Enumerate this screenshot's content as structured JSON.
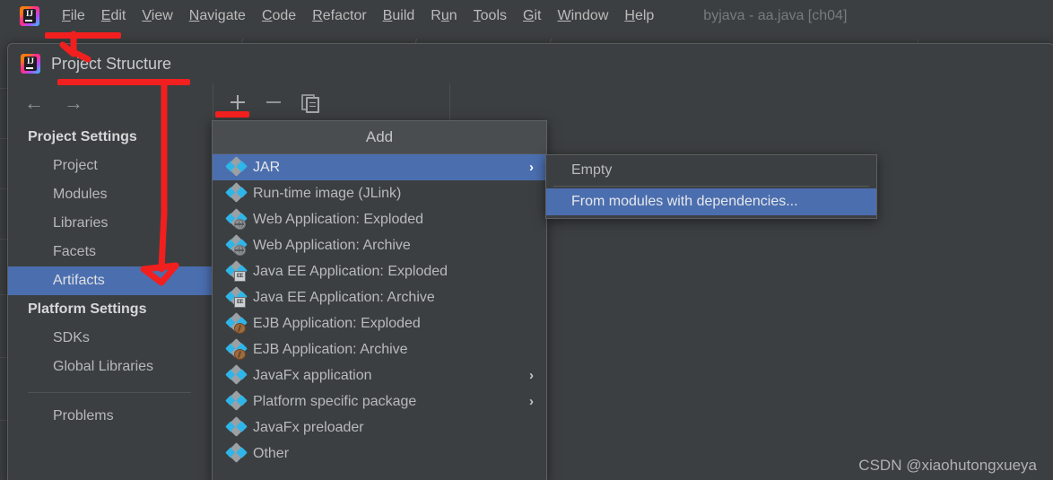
{
  "ide": {
    "logo_alt": "intellij-idea-logo",
    "window_title": "byjava - aa.java [ch04]",
    "menus": [
      {
        "mnemonic": "F",
        "rest": "ile"
      },
      {
        "mnemonic": "E",
        "rest": "dit"
      },
      {
        "mnemonic": "V",
        "rest": "iew"
      },
      {
        "mnemonic": "N",
        "rest": "avigate"
      },
      {
        "mnemonic": "C",
        "rest": "ode"
      },
      {
        "mnemonic": "R",
        "rest": "efactor"
      },
      {
        "mnemonic": "B",
        "rest": "uild"
      },
      {
        "mnemonic": "R",
        "rest": "un",
        "prefix": "R",
        "mid": "u",
        "suffix": "n"
      },
      {
        "mnemonic": "T",
        "rest": "ools"
      },
      {
        "mnemonic": "G",
        "rest": "it"
      },
      {
        "mnemonic": "W",
        "rest": "indow"
      },
      {
        "mnemonic": "H",
        "rest": "elp"
      }
    ]
  },
  "dialog": {
    "title": "Project Structure",
    "nav_back": "←",
    "nav_forward": "→",
    "sidebar": {
      "groups": [
        {
          "label": "Project Settings",
          "items": [
            {
              "label": "Project",
              "selected": false
            },
            {
              "label": "Modules",
              "selected": false
            },
            {
              "label": "Libraries",
              "selected": false
            },
            {
              "label": "Facets",
              "selected": false
            },
            {
              "label": "Artifacts",
              "selected": true
            }
          ]
        },
        {
          "label": "Platform Settings",
          "items": [
            {
              "label": "SDKs",
              "selected": false
            },
            {
              "label": "Global Libraries",
              "selected": false
            }
          ]
        }
      ],
      "footer_items": [
        {
          "label": "Problems",
          "selected": false
        }
      ]
    },
    "toolbar": {
      "add": "add-icon",
      "remove": "remove-icon",
      "copy": "copy-icon"
    }
  },
  "add_menu": {
    "header": "Add",
    "items": [
      {
        "label": "JAR",
        "icon": "artifact-jar-icon",
        "badge": "none",
        "submenu": true,
        "selected": true
      },
      {
        "label": "Run-time image (JLink)",
        "icon": "artifact-jlink-icon",
        "badge": "none",
        "submenu": false,
        "selected": false
      },
      {
        "label": "Web Application: Exploded",
        "icon": "artifact-web-icon",
        "badge": "globe",
        "submenu": false,
        "selected": false
      },
      {
        "label": "Web Application: Archive",
        "icon": "artifact-web-icon",
        "badge": "globe",
        "submenu": false,
        "selected": false
      },
      {
        "label": "Java EE Application: Exploded",
        "icon": "artifact-javaee-icon",
        "badge": "ee",
        "badge_text": "EE",
        "submenu": false,
        "selected": false
      },
      {
        "label": "Java EE Application: Archive",
        "icon": "artifact-javaee-icon",
        "badge": "ee",
        "badge_text": "EE",
        "submenu": false,
        "selected": false
      },
      {
        "label": "EJB Application: Exploded",
        "icon": "artifact-ejb-icon",
        "badge": "bean",
        "submenu": false,
        "selected": false
      },
      {
        "label": "EJB Application: Archive",
        "icon": "artifact-ejb-icon",
        "badge": "bean",
        "submenu": false,
        "selected": false
      },
      {
        "label": "JavaFx application",
        "icon": "artifact-javafx-icon",
        "badge": "none",
        "submenu": true,
        "selected": false
      },
      {
        "label": "Platform specific package",
        "icon": "artifact-platform-icon",
        "badge": "none",
        "submenu": true,
        "selected": false
      },
      {
        "label": "JavaFx preloader",
        "icon": "artifact-javafx-preloader-icon",
        "badge": "none",
        "submenu": false,
        "selected": false
      },
      {
        "label": "Other",
        "icon": "artifact-other-icon",
        "badge": "none",
        "submenu": false,
        "selected": false
      }
    ],
    "submenu_arrow": "›"
  },
  "jar_submenu": {
    "items": [
      {
        "label": "Empty",
        "selected": false
      },
      {
        "label": "From modules with dependencies...",
        "selected": true
      }
    ]
  },
  "watermark": "CSDN @xiaohutongxueya",
  "colors": {
    "dialog_bg": "#3c3f41",
    "selection_blue": "#4b6eaf",
    "menu_header_bg": "#4a4d4f",
    "text_primary": "#b8babc",
    "annotation_red": "#f21f1f",
    "icon_cyan": "#2fb5e8",
    "icon_gray": "#9aa0a4"
  }
}
